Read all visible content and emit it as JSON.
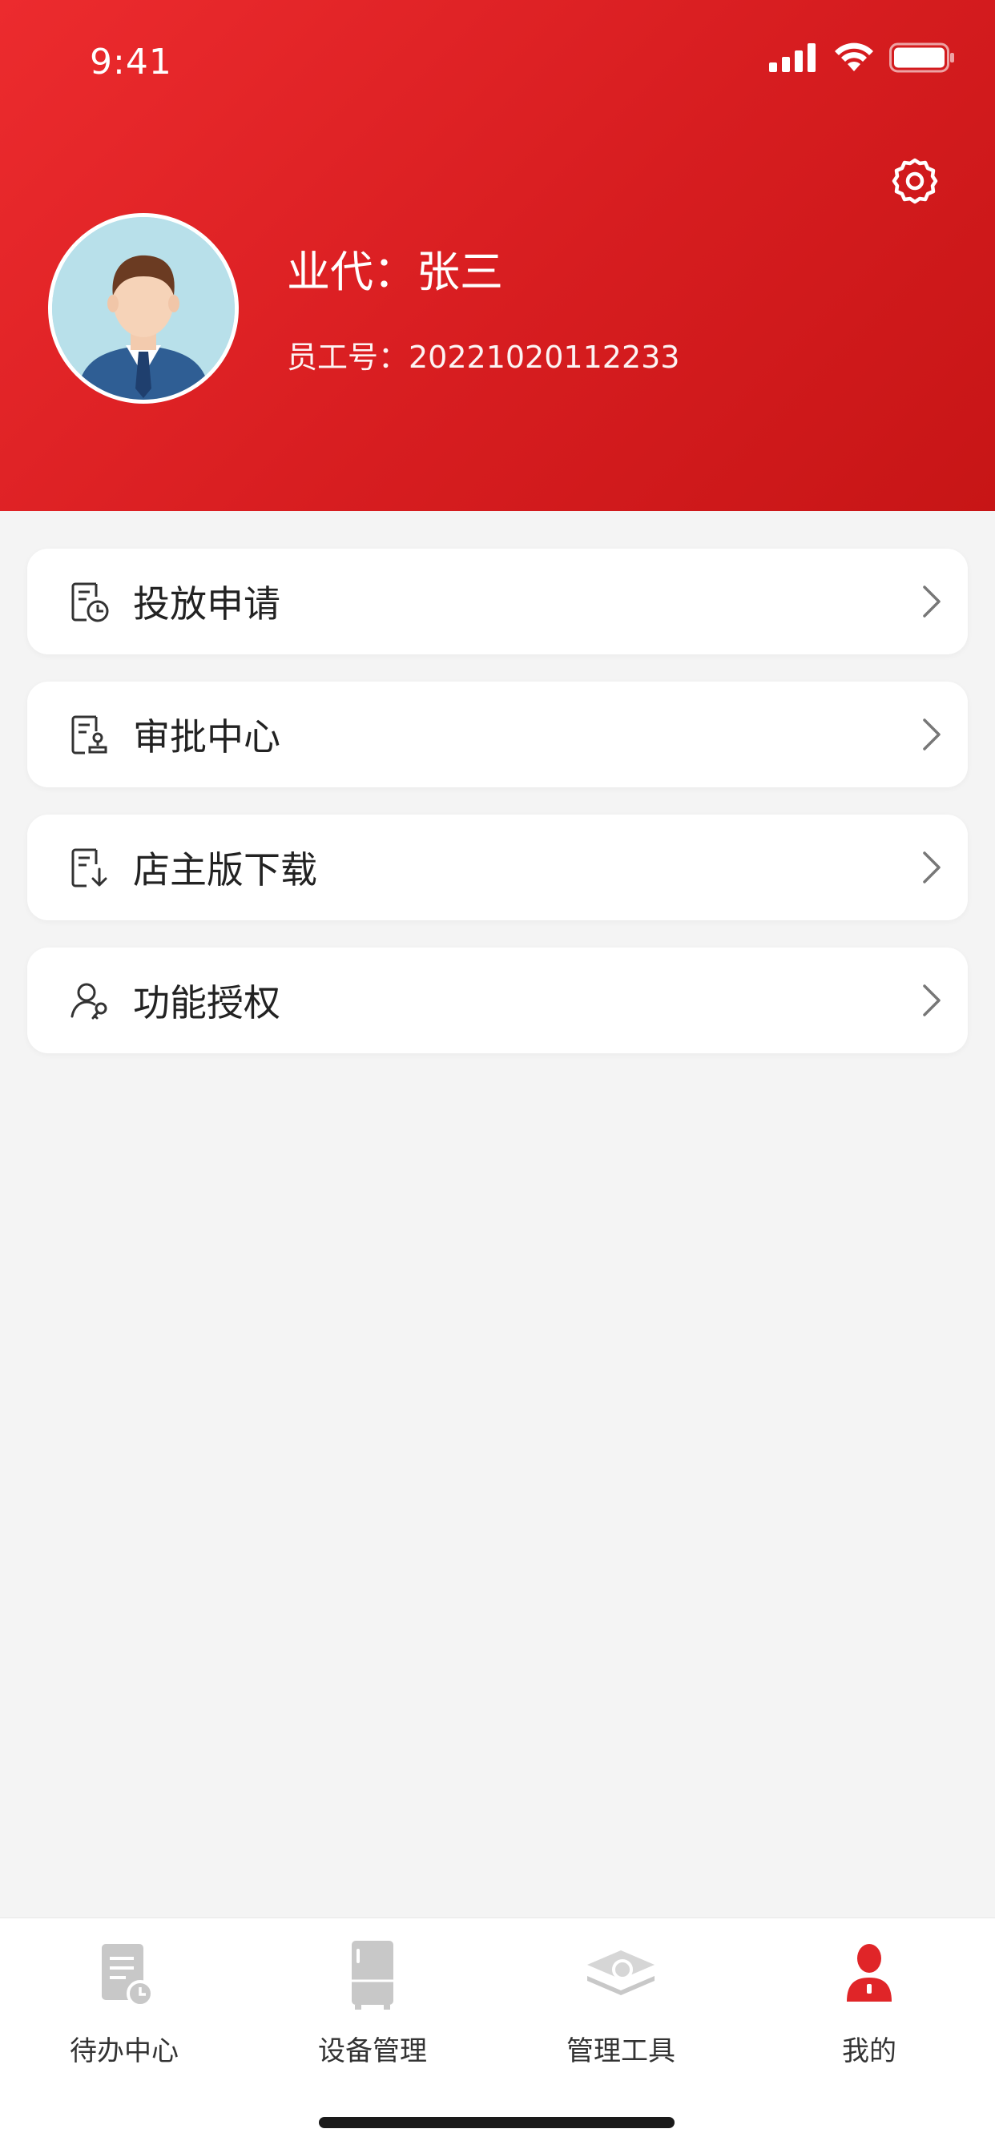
{
  "status_bar": {
    "time": "9:41"
  },
  "profile": {
    "name": "业代：张三",
    "employee_id": "员工号：20221020112233"
  },
  "menu": {
    "items": [
      {
        "label": "投放申请",
        "icon": "document-stamp-icon"
      },
      {
        "label": "审批中心",
        "icon": "approval-document-icon"
      },
      {
        "label": "店主版下载",
        "icon": "document-download-icon"
      },
      {
        "label": "功能授权",
        "icon": "user-key-icon"
      }
    ]
  },
  "tabbar": {
    "items": [
      {
        "label": "待办中心",
        "icon": "todo-document-icon",
        "active": false
      },
      {
        "label": "设备管理",
        "icon": "fridge-icon",
        "active": false
      },
      {
        "label": "管理工具",
        "icon": "tools-layers-icon",
        "active": false
      },
      {
        "label": "我的",
        "icon": "user-icon",
        "active": true
      }
    ]
  },
  "colors": {
    "header_start": "#ec2b2e",
    "header_end": "#c71516",
    "accent": "#e02528",
    "inactive_icon": "#c8c8c8"
  }
}
